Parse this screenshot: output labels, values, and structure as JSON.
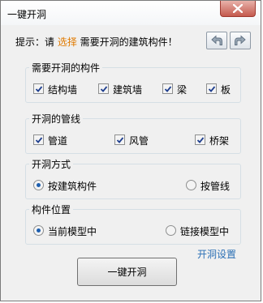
{
  "window": {
    "title": "一键开洞"
  },
  "hint": {
    "prefix": "提示：请 ",
    "highlight": "选择",
    "suffix": " 需要开洞的建筑构件！"
  },
  "groups": {
    "components": {
      "title": "需要开洞的构件",
      "options": [
        {
          "label": "结构墙",
          "checked": true
        },
        {
          "label": "建筑墙",
          "checked": true
        },
        {
          "label": "梁",
          "checked": true
        },
        {
          "label": "板",
          "checked": true
        }
      ]
    },
    "pipelines": {
      "title": "开洞的管线",
      "options": [
        {
          "label": "管道",
          "checked": true
        },
        {
          "label": "风管",
          "checked": true
        },
        {
          "label": "桥架",
          "checked": true
        }
      ]
    },
    "method": {
      "title": "开洞方式",
      "options": [
        {
          "label": "按建筑构件",
          "selected": true
        },
        {
          "label": "按管线",
          "selected": false
        }
      ]
    },
    "location": {
      "title": "构件位置",
      "options": [
        {
          "label": "当前模型中",
          "selected": true
        },
        {
          "label": "链接模型中",
          "selected": false
        }
      ]
    }
  },
  "settings_link": "开洞设置",
  "run_button": "一键开洞",
  "icons": {
    "undo": "undo-arrow-icon",
    "redo": "redo-arrow-icon",
    "close": "close-icon"
  },
  "colors": {
    "highlight": "#e07a00",
    "link": "#2a6fb5",
    "close_button": "#c45a4e"
  }
}
